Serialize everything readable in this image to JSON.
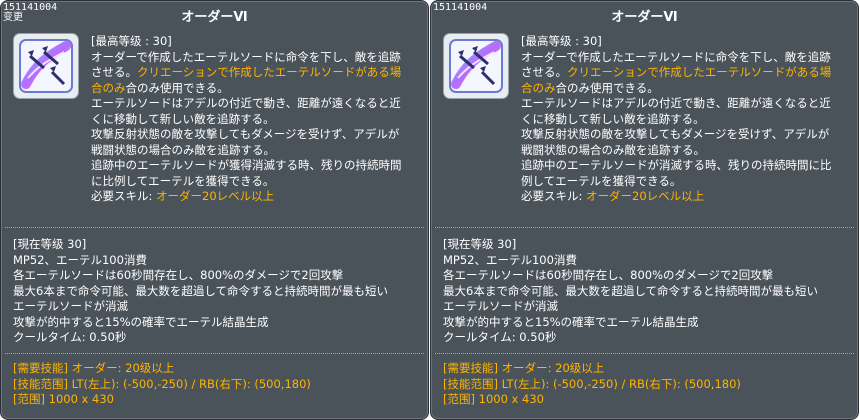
{
  "colors": {
    "panel_bg": "#4a525a",
    "highlight": "#ffb400",
    "text": "#ffffff"
  },
  "tooltips": [
    {
      "skill_id": "151141004",
      "sub_label": "变更",
      "title": "オーダーⅥ",
      "icon": "ether-sword-skill-icon",
      "max_level": "[最高等级 : 30]",
      "desc_lines": [
        "オーダーで作成したエーテルソードに命令を下し、敵を追跡",
        "させる。",
        "合のみ使用できる。",
        "エーテルソードはアデルの付近で動き、距離が遠くなると近",
        "くに移動して新しい敵を追跡する。",
        "攻撃反射状態の敵を攻撃してもダメージを受けず、アデルが",
        "戦闘状態の場合のみ敵を追跡する。",
        "追跡中のエーテルソードが獲得消滅する時、残りの持続時間",
        "に比例してエーテルを獲得できる。"
      ],
      "desc_highlight_1": "クリエーションで作成したエーテルソードがある場",
      "desc_highlight_2": "合のみ",
      "required_skill_label": "必要スキル: ",
      "required_skill_value": "オーダー20レベル以上",
      "current_level": "[現在等级 30]",
      "stats": [
        "MP52、エーテル100消費",
        "各エーテルソードは60秒間存在し、800%のダメージで2回攻撃",
        "最大6本まで命令可能、最大数を超過して命令すると持続時間が最も短い",
        "エーテルソードが消滅",
        "攻撃が的中すると15%の確率でエーテル結晶生成",
        "クールタイム: 0.50秒"
      ],
      "requirements": [
        "[需要技能] オーダー: 20级以上",
        "[技能范围] LT(左上): (-500,-250) / RB(右下): (500,180)",
        "[范围] 1000 x 430"
      ]
    },
    {
      "skill_id": "151141004",
      "sub_label": "",
      "title": "オーダーⅥ",
      "icon": "ether-sword-skill-icon",
      "max_level": "[最高等级 : 30]",
      "desc_lines": [
        "オーダーで作成したエーテルソードに命令を下し、敵を追跡",
        "させる。",
        "合のみ使用できる。",
        "エーテルソードはアデルの付近で動き、距離が遠くなると近",
        "くに移動して新しい敵を追跡する。",
        "攻撃反射状態の敵を攻撃してもダメージを受けず、アデルが",
        "戦闘状態の場合のみ敵を追跡する。",
        "追跡中のエーテルソードが消滅する時、残りの持続時間に比",
        "例してエーテルを獲得できる。"
      ],
      "desc_highlight_1": "クリエーションで作成したエーテルソードがある場",
      "desc_highlight_2": "合のみ",
      "required_skill_label": "必要スキル: ",
      "required_skill_value": "オーダー20レベル以上",
      "current_level": "[現在等级 30]",
      "stats": [
        "MP52、エーテル100消費",
        "各エーテルソードは60秒間存在し、800%のダメージで2回攻撃",
        "最大6本まで命令可能、最大数を超過して命令すると持続時間が最も短い",
        "エーテルソードが消滅",
        "攻撃が的中すると15%の確率でエーテル結晶生成",
        "クールタイム: 0.50秒"
      ],
      "requirements": [
        "[需要技能] オーダー: 20级以上",
        "[技能范围] LT(左上): (-500,-250) / RB(右下): (500,180)",
        "[范围] 1000 x 430"
      ]
    }
  ]
}
